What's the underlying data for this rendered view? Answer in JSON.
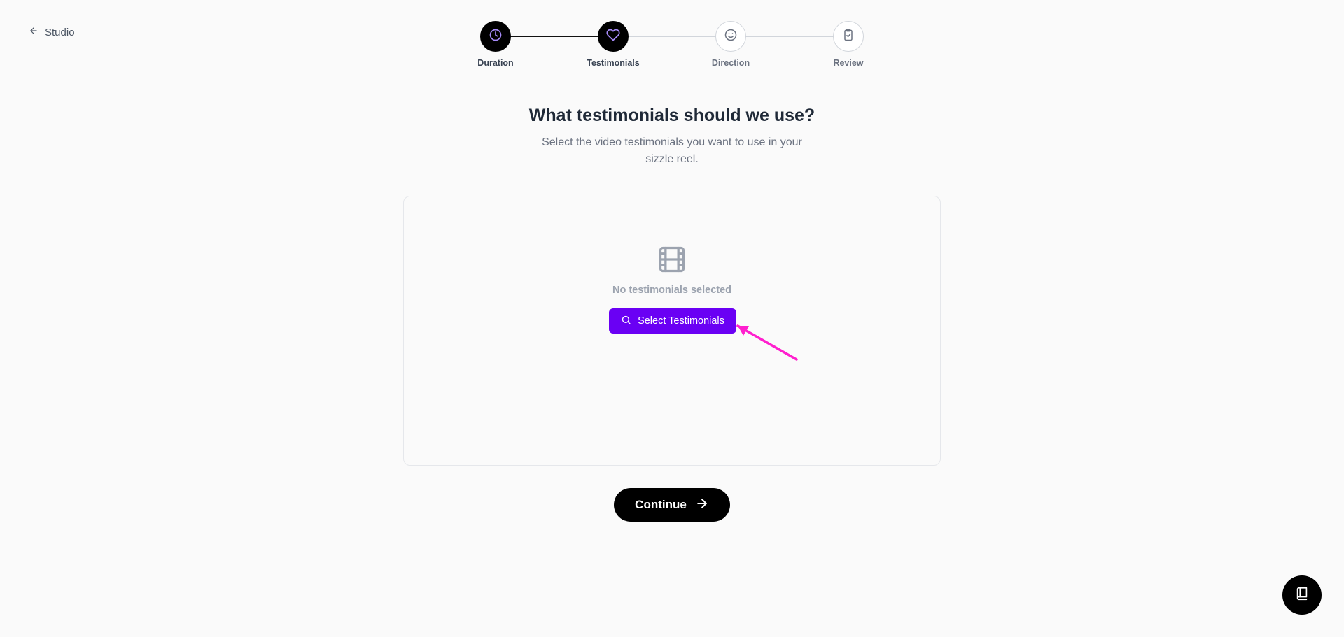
{
  "nav": {
    "back_label": "Studio",
    "back_icon": "arrow-left-icon"
  },
  "stepper": {
    "steps": [
      {
        "label": "Duration",
        "icon": "clock-icon",
        "state": "completed"
      },
      {
        "label": "Testimonials",
        "icon": "heart-icon",
        "state": "current"
      },
      {
        "label": "Direction",
        "icon": "smile-icon",
        "state": "upcoming"
      },
      {
        "label": "Review",
        "icon": "clipboard-check-icon",
        "state": "upcoming"
      }
    ]
  },
  "main": {
    "title": "What testimonials should we use?",
    "subtitle": "Select the video testimonials you want to use in your sizzle reel."
  },
  "panel": {
    "empty_icon": "film-icon",
    "empty_text": "No testimonials selected",
    "select_button_label": "Select Testimonials",
    "select_button_icon": "search-icon"
  },
  "footer": {
    "continue_label": "Continue",
    "continue_icon": "arrow-right-icon"
  },
  "fab": {
    "icon": "book-icon"
  },
  "colors": {
    "accent": "#6a00f4",
    "accent_icon": "#a78bfa",
    "annotation_arrow": "#ff1fce",
    "background": "#fafafa",
    "primary_dark": "#000000"
  }
}
